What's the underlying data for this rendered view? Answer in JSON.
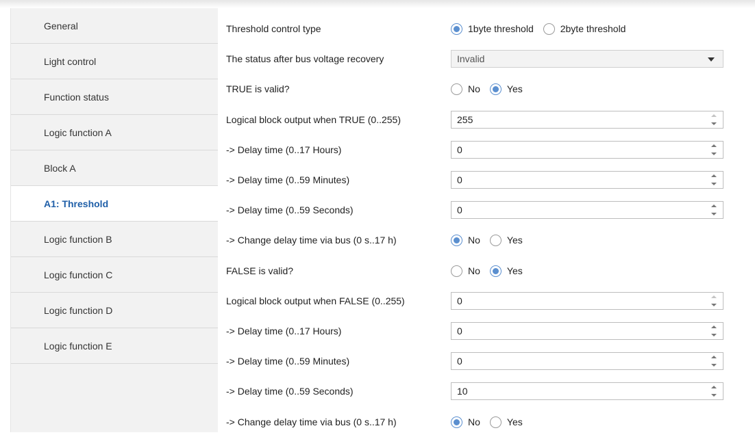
{
  "sidebar": {
    "items": [
      {
        "label": "General"
      },
      {
        "label": "Light control"
      },
      {
        "label": "Function status"
      },
      {
        "label": "Logic function A"
      },
      {
        "label": "Block A"
      },
      {
        "label": "A1: Threshold",
        "active": true
      },
      {
        "label": "Logic function B"
      },
      {
        "label": "Logic function C"
      },
      {
        "label": "Logic function D"
      },
      {
        "label": "Logic function E"
      }
    ]
  },
  "params": {
    "threshold_type": {
      "label": "Threshold control type",
      "opt1": "1byte threshold",
      "opt2": "2byte threshold",
      "selected": "1byte threshold"
    },
    "status_recovery": {
      "label": "The status after bus voltage recovery",
      "value": "Invalid"
    },
    "true_valid": {
      "label": "TRUE is valid?",
      "opt1": "No",
      "opt2": "Yes",
      "selected": "Yes"
    },
    "true_output": {
      "label": "Logical block output when TRUE (0..255)",
      "value": "255"
    },
    "true_hours": {
      "label": "-> Delay time (0..17 Hours)",
      "value": "0"
    },
    "true_minutes": {
      "label": "-> Delay time (0..59 Minutes)",
      "value": "0"
    },
    "true_seconds": {
      "label": "-> Delay time (0..59 Seconds)",
      "value": "0"
    },
    "true_change": {
      "label": "-> Change delay time via bus (0 s..17 h)",
      "opt1": "No",
      "opt2": "Yes",
      "selected": "No"
    },
    "false_valid": {
      "label": "FALSE is valid?",
      "opt1": "No",
      "opt2": "Yes",
      "selected": "Yes"
    },
    "false_output": {
      "label": "Logical block output when FALSE (0..255)",
      "value": "0"
    },
    "false_hours": {
      "label": "-> Delay time (0..17 Hours)",
      "value": "0"
    },
    "false_minutes": {
      "label": "-> Delay time (0..59 Minutes)",
      "value": "0"
    },
    "false_seconds": {
      "label": "-> Delay time (0..59 Seconds)",
      "value": "10"
    },
    "false_change": {
      "label": "-> Change delay time via bus (0 s..17 h)",
      "opt1": "No",
      "opt2": "Yes",
      "selected": "No"
    }
  },
  "colors": {
    "accent": "#5b8fcf",
    "active_item": "#1f5fa8",
    "sidebar_bg": "#f2f2f2"
  },
  "icons": [
    "chevron-down-icon",
    "spin-up-icon",
    "spin-down-icon"
  ]
}
